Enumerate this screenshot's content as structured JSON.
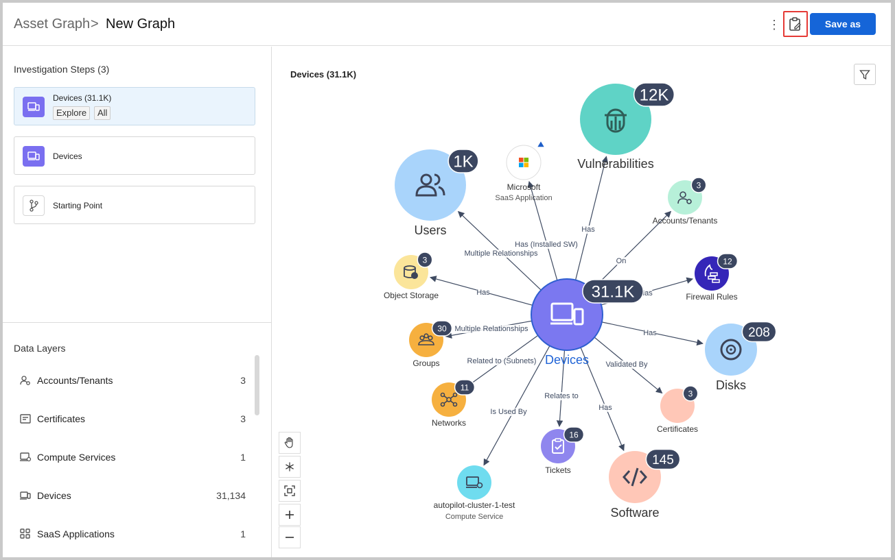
{
  "header": {
    "breadcrumb_parent": "Asset Graph",
    "breadcrumb_separator": ">",
    "title": "New Graph",
    "more_icon": "kebab-vertical-icon",
    "clipboard_icon": "clipboard-edit-icon",
    "save_label": "Save as"
  },
  "sidebar": {
    "investigation_title": "Investigation Steps (3)",
    "steps": [
      {
        "label": "Devices (31.1K)",
        "icon": "devices-icon",
        "chips": [
          "Explore",
          "All"
        ],
        "active": true
      },
      {
        "label": "Devices",
        "icon": "devices-icon"
      },
      {
        "label": "Starting Point",
        "icon": "branch-icon"
      }
    ],
    "data_layers_title": "Data Layers",
    "data_layers": [
      {
        "label": "Accounts/Tenants",
        "count": "3",
        "icon": "accounts-icon"
      },
      {
        "label": "Certificates",
        "count": "3",
        "icon": "certificate-icon"
      },
      {
        "label": "Compute Services",
        "count": "1",
        "icon": "compute-icon"
      },
      {
        "label": "Devices",
        "count": "31,134",
        "icon": "devices-icon"
      },
      {
        "label": "SaaS Applications",
        "count": "1",
        "icon": "apps-icon"
      }
    ]
  },
  "canvas": {
    "title": "Devices (31.1K)",
    "filter_icon": "filter-icon",
    "tools": [
      "hand-icon",
      "snowflake-icon",
      "fit-screen-icon",
      "zoom-in-icon",
      "zoom-out-icon"
    ]
  },
  "graph": {
    "center": {
      "label": "Devices",
      "badge": "31.1K",
      "color": "#7b78f0"
    },
    "nodes": [
      {
        "id": "users",
        "label": "Users",
        "badge": "1K",
        "color": "#a9d4fb"
      },
      {
        "id": "microsoft",
        "label": "Microsoft",
        "sublabel": "SaaS Application",
        "color": "#ffffff"
      },
      {
        "id": "vulnerabilities",
        "label": "Vulnerabilities",
        "badge": "12K",
        "color": "#5fd3c6"
      },
      {
        "id": "accounts",
        "label": "Accounts/Tenants",
        "badge": "3",
        "color": "#b7f0d9"
      },
      {
        "id": "object_storage",
        "label": "Object Storage",
        "badge": "3",
        "color": "#fbe59a"
      },
      {
        "id": "firewall",
        "label": "Firewall Rules",
        "badge": "12",
        "color": "#3526b8"
      },
      {
        "id": "groups",
        "label": "Groups",
        "badge": "30",
        "color": "#f6b03f"
      },
      {
        "id": "disks",
        "label": "Disks",
        "badge": "208",
        "color": "#a9d4fb"
      },
      {
        "id": "networks",
        "label": "Networks",
        "badge": "11",
        "color": "#f6b03f"
      },
      {
        "id": "certificates",
        "label": "Certificates",
        "badge": "3",
        "color": "#ffc7b7"
      },
      {
        "id": "tickets",
        "label": "Tickets",
        "badge": "16",
        "color": "#8f86ee"
      },
      {
        "id": "compute",
        "label": "autopilot-cluster-1-test",
        "sublabel": "Compute Service",
        "color": "#6fdcef"
      },
      {
        "id": "software",
        "label": "Software",
        "badge": "145",
        "color": "#ffc7b7"
      }
    ],
    "edges": [
      {
        "to": "users",
        "label": "Multiple Relationships"
      },
      {
        "to": "microsoft",
        "label": "Has (Installed SW)"
      },
      {
        "to": "vulnerabilities",
        "label": "Has"
      },
      {
        "to": "accounts",
        "label": "On"
      },
      {
        "to": "object_storage",
        "label": "Has"
      },
      {
        "to": "firewall",
        "label": "Has"
      },
      {
        "to": "groups",
        "label": "Multiple Relationships"
      },
      {
        "to": "disks",
        "label": "Has"
      },
      {
        "to": "networks",
        "label": "Related to (Subnets)"
      },
      {
        "to": "certificates",
        "label": "Validated By"
      },
      {
        "to": "tickets",
        "label": "Relates to"
      },
      {
        "to": "compute",
        "label": "Is Used By"
      },
      {
        "to": "software",
        "label": "Has"
      }
    ]
  }
}
